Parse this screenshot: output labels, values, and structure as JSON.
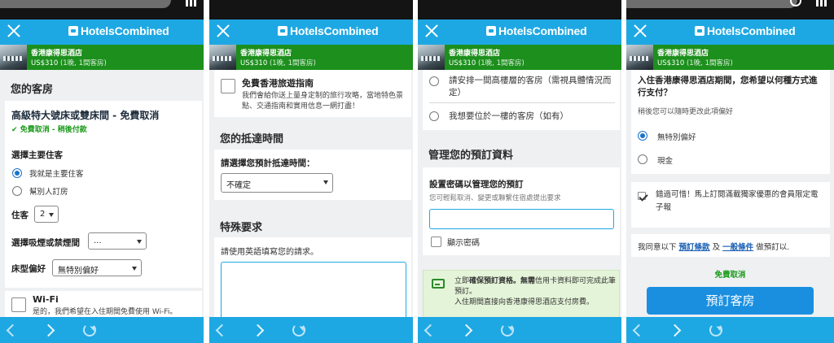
{
  "app": {
    "logo_text": "HotelsCombined"
  },
  "hotel": {
    "name": "香港康得思酒店",
    "price": "US$310",
    "price_sub": "(1晚, 1間客房)"
  },
  "p1": {
    "section_title": "您的客房",
    "room_title": "高級特大號床或雙床間 - 免費取消",
    "free_cancel": "免費取消 - 稍後付款",
    "guest_label": "選擇主要住客",
    "guest_opt1": "我就是主要住客",
    "guest_opt2": "幫別人訂房",
    "guests_label": "住客",
    "guests_value": "2",
    "smoking_label": "選擇吸煙或禁煙間",
    "smoking_value": "...",
    "bed_label": "床型偏好",
    "bed_value": "無特別偏好",
    "wifi_title": "Wi-Fi",
    "wifi_desc": "是的，我們希望在入住期間免費使用 Wi-Fi。"
  },
  "p2": {
    "guide_title": "免費香港旅遊指南",
    "guide_desc": "我們會給你送上量身定制的旅行攻略，當地特色景點、交通指南和實用信息一網打盡！",
    "arrival_title": "您的抵達時間",
    "arrival_label": "請選擇您預計抵達時間：",
    "arrival_value": "不確定",
    "special_title": "特殊要求",
    "special_label": "請使用英語填寫您的請求。"
  },
  "p3": {
    "opt_high_floor": "請安排一間高樓層的客房（需視具體情況而定）",
    "opt_ground_floor": "我想要位於一樓的客房（如有）",
    "manage_title": "管理您的預訂資料",
    "password_label": "設置密碼以管理您的預訂",
    "password_desc": "您可輕鬆取消、變更或聯繫住宿處提出要求",
    "show_password": "顯示密碼",
    "secure_bold": "確保預訂資格。無需",
    "secure_text1": "立即",
    "secure_text2": "信用卡資料即可完成此筆預訂。",
    "secure_text3": "入住期間直接向香港康得思酒店支付房費。"
  },
  "p4": {
    "pay_question": "入住香港康得思酒店期間，您希望以何種方式進行支付？",
    "pay_note": "稍後您可以隨時更改此項偏好",
    "pay_opt1": "無特別偏好",
    "pay_opt2": "現金",
    "promo_text": "錯過可惜！馬上訂閱滿載獨家優惠的會員限定電子報",
    "agree_prefix": "我同意以下",
    "terms_link": "預訂條款",
    "and_text": "及",
    "conditions_link": "一般條件",
    "agree_suffix": "做預訂以.",
    "free_cancel": "免費取消",
    "book_button": "預訂客房"
  },
  "colors": {
    "brand_blue": "#1ea8e3",
    "hotel_green": "#1c8f1c",
    "button_blue": "#1a8fe0",
    "free_green": "#1a9a1a"
  }
}
